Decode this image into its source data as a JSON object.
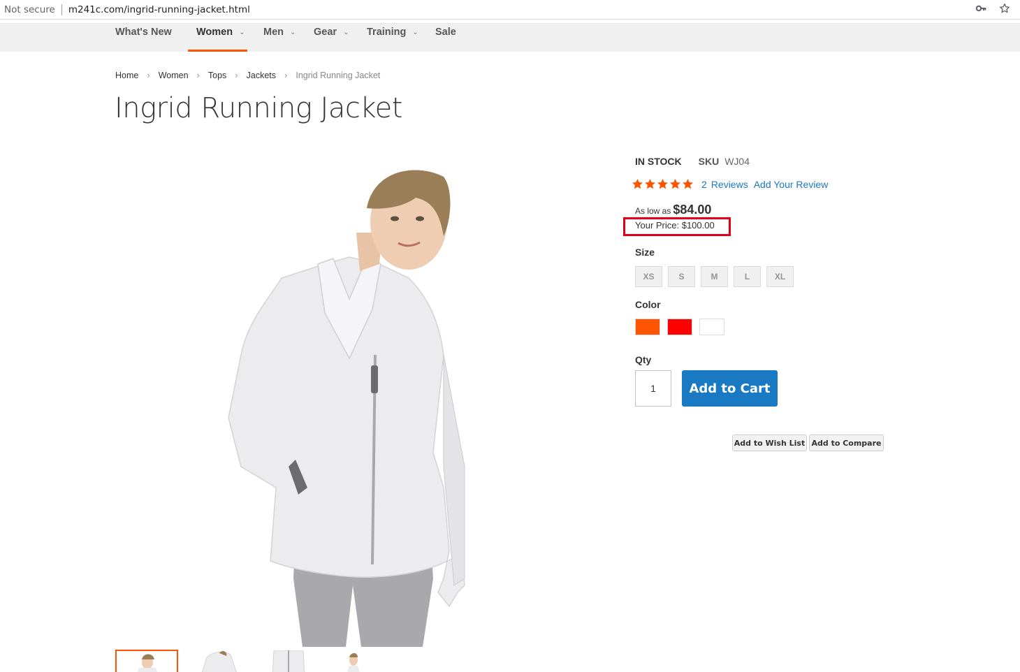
{
  "browser": {
    "security": "Not secure",
    "url": "m241c.com/ingrid-running-jacket.html"
  },
  "nav": {
    "items": [
      {
        "label": "What's New",
        "has_dropdown": false,
        "active": false
      },
      {
        "label": "Women",
        "has_dropdown": true,
        "active": true
      },
      {
        "label": "Men",
        "has_dropdown": true,
        "active": false
      },
      {
        "label": "Gear",
        "has_dropdown": true,
        "active": false
      },
      {
        "label": "Training",
        "has_dropdown": true,
        "active": false
      },
      {
        "label": "Sale",
        "has_dropdown": false,
        "active": false
      }
    ]
  },
  "breadcrumbs": [
    "Home",
    "Women",
    "Tops",
    "Jackets",
    "Ingrid Running Jacket"
  ],
  "product": {
    "title": "Ingrid Running Jacket",
    "stock": "IN STOCK",
    "sku_label": "SKU",
    "sku": "WJ04",
    "rating_stars": 5,
    "review_count": "2",
    "reviews_label": "Reviews",
    "add_review": "Add Your Review",
    "as_low_as_label": "As low as",
    "as_low_as_price": "$84.00",
    "your_price": "Your Price: $100.00",
    "size_label": "Size",
    "sizes": [
      "XS",
      "S",
      "M",
      "L",
      "XL"
    ],
    "color_label": "Color",
    "colors": [
      "#ff5501",
      "#ff0000",
      "#ffffff"
    ],
    "qty_label": "Qty",
    "qty": "1",
    "add_to_cart": "Add to Cart",
    "add_to_wishlist": "Add to Wish List",
    "add_to_compare": "Add to Compare"
  },
  "colors": {
    "accent": "#ff5501",
    "link": "#1979c3",
    "star": "#ff5501",
    "highlight_box": "#e0001a"
  }
}
